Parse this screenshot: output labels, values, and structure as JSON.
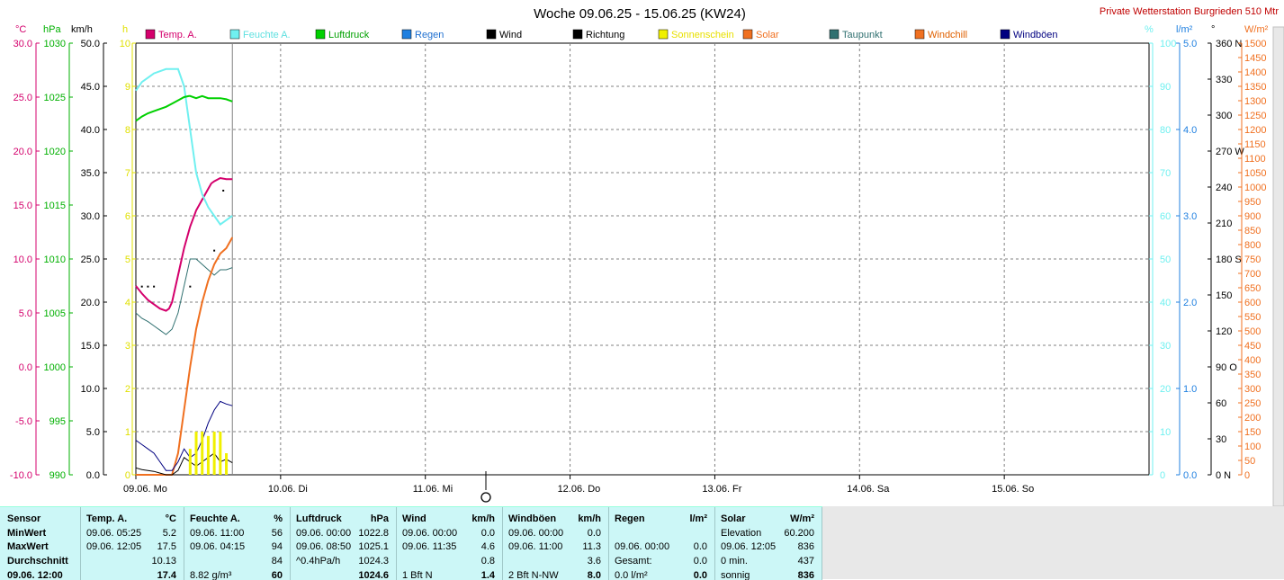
{
  "header": {
    "title": "Woche 09.06.25 - 15.06.25 (KW24)",
    "station": "Private Wetterstation Burgrieden 510 Mtr"
  },
  "axes": {
    "temp": {
      "unit": "°C",
      "ticks": [
        "30.0",
        "25.0",
        "20.0",
        "15.0",
        "10.0",
        "5.0",
        "0.0",
        "-5.0",
        "-10.0"
      ],
      "color": "#d4006c"
    },
    "pressure": {
      "unit": "hPa",
      "ticks": [
        "1030",
        "1025",
        "1020",
        "1015",
        "1010",
        "1005",
        "1000",
        "995",
        "990"
      ],
      "color": "#00b000"
    },
    "wind": {
      "unit": "km/h",
      "ticks": [
        "50.0",
        "45.0",
        "40.0",
        "35.0",
        "30.0",
        "25.0",
        "20.0",
        "15.0",
        "10.0",
        "5.0",
        "0.0"
      ],
      "color": "#000000"
    },
    "sunshine": {
      "unit": "h",
      "ticks": [
        "10",
        "9",
        "8",
        "7",
        "6",
        "5",
        "4",
        "3",
        "2",
        "1",
        "0"
      ],
      "color": "#e0e000"
    },
    "humidity": {
      "unit": "%",
      "ticks": [
        "100",
        "90",
        "80",
        "70",
        "60",
        "50",
        "40",
        "30",
        "20",
        "10",
        "0"
      ],
      "color": "#70f0f0"
    },
    "rain": {
      "unit": "l/m²",
      "ticks": [
        "5.0",
        "4.0",
        "3.0",
        "2.0",
        "1.0",
        "0.0"
      ],
      "color": "#2080e0"
    },
    "direction": {
      "unit": "°",
      "ticks": [
        "360 N",
        "330",
        "300",
        "270 W",
        "240",
        "210",
        "180 S",
        "150",
        "120",
        "90 O",
        "60",
        "30",
        "0 N"
      ],
      "color": "#000000"
    },
    "solar": {
      "unit": "W/m²",
      "ticks": [
        "1500",
        "1450",
        "1400",
        "1350",
        "1300",
        "1250",
        "1200",
        "1150",
        "1100",
        "1050",
        "1000",
        "950",
        "900",
        "850",
        "800",
        "750",
        "700",
        "650",
        "600",
        "550",
        "500",
        "450",
        "400",
        "350",
        "300",
        "250",
        "200",
        "150",
        "100",
        "50",
        "0"
      ],
      "color": "#f07020"
    }
  },
  "legend": [
    {
      "label": "Temp. A.",
      "color": "#d4006c"
    },
    {
      "label": "Feuchte A.",
      "color": "#70f0f0"
    },
    {
      "label": "Luftdruck",
      "color": "#00d000"
    },
    {
      "label": "Regen",
      "color": "#2080e0"
    },
    {
      "label": "Wind",
      "color": "#000000"
    },
    {
      "label": "Richtung",
      "color": "#000000"
    },
    {
      "label": "Sonnenschein",
      "color": "#f0f000"
    },
    {
      "label": "Solar",
      "color": "#f07020"
    },
    {
      "label": "Taupunkt",
      "color": "#307070"
    },
    {
      "label": "Windchill",
      "color": "#f07020"
    },
    {
      "label": "Windböen",
      "color": "#000080"
    }
  ],
  "days": [
    "09.06.  Mo",
    "10.06.  Di",
    "11.06.  Mi",
    "12.06.  Do",
    "13.06.  Fr",
    "14.06.  Sa",
    "15.06.  So"
  ],
  "chart_data": {
    "type": "line",
    "x_unit": "hours since 09.06. 00:00",
    "xlim": [
      0,
      168
    ],
    "series": [
      {
        "name": "Temp. A.",
        "unit": "°C",
        "color": "#d4006c",
        "x": [
          0,
          1,
          2,
          3,
          4,
          5,
          5.5,
          6,
          7,
          8,
          9,
          10,
          11,
          12,
          12.5,
          13,
          14,
          15,
          16
        ],
        "values": [
          7.5,
          6.8,
          6.2,
          5.8,
          5.4,
          5.2,
          5.4,
          6.0,
          8.5,
          11.0,
          13.0,
          14.5,
          15.5,
          16.5,
          17.0,
          17.2,
          17.5,
          17.4,
          17.4
        ]
      },
      {
        "name": "Feuchte A.",
        "unit": "%",
        "color": "#70f0f0",
        "x": [
          0,
          1,
          2,
          3,
          4,
          5,
          6,
          7,
          8,
          9,
          10,
          11,
          12,
          13,
          14,
          15,
          16
        ],
        "values": [
          89,
          91,
          92,
          93,
          93.5,
          94,
          94,
          94,
          90,
          80,
          70,
          65,
          62,
          60,
          58,
          59,
          60
        ]
      },
      {
        "name": "Luftdruck",
        "unit": "hPa",
        "color": "#00d000",
        "x": [
          0,
          1,
          2,
          3,
          4,
          5,
          6,
          7,
          8,
          8.8,
          9,
          10,
          11,
          12,
          13,
          14,
          15,
          16
        ],
        "values": [
          1022.8,
          1023.2,
          1023.5,
          1023.7,
          1023.9,
          1024.1,
          1024.4,
          1024.7,
          1025.0,
          1025.1,
          1025.1,
          1024.9,
          1025.1,
          1024.9,
          1024.9,
          1024.9,
          1024.8,
          1024.6
        ]
      },
      {
        "name": "Taupunkt",
        "unit": "°C",
        "color": "#307070",
        "x": [
          0,
          1,
          2,
          3,
          4,
          5,
          6,
          7,
          8,
          9,
          10,
          11,
          12,
          13,
          14,
          15,
          16
        ],
        "values": [
          5.0,
          4.5,
          4.2,
          3.8,
          3.4,
          3.0,
          3.5,
          5.0,
          7.5,
          10.0,
          10.0,
          9.5,
          9.0,
          8.5,
          9.0,
          9.0,
          9.2
        ]
      },
      {
        "name": "Windchill",
        "unit": "°C",
        "color": "#f07020",
        "x": [
          0,
          5,
          6,
          7,
          8,
          9,
          10,
          11,
          12,
          13,
          14,
          15,
          16
        ],
        "values": [
          -10,
          -10,
          -10,
          -8,
          -4,
          0,
          3.5,
          6.0,
          8.0,
          9.5,
          10.5,
          11.0,
          12.0
        ]
      },
      {
        "name": "Wind",
        "unit": "km/h",
        "color": "#000000",
        "x": [
          0,
          1,
          2,
          3,
          4,
          5,
          6,
          7,
          8,
          9,
          10,
          11,
          12,
          13,
          14,
          15,
          16
        ],
        "values": [
          0.8,
          0.6,
          0.5,
          0.4,
          0.2,
          0.0,
          0.0,
          0.5,
          2.0,
          1.5,
          1.0,
          1.5,
          2.0,
          2.5,
          1.5,
          1.8,
          1.4
        ]
      },
      {
        "name": "Windböen",
        "unit": "km/h",
        "color": "#000080",
        "x": [
          0,
          1,
          2,
          3,
          4,
          5,
          6,
          7,
          8,
          9,
          10,
          11,
          12,
          13,
          14,
          15,
          16
        ],
        "values": [
          4.0,
          3.5,
          3.0,
          2.5,
          1.5,
          0.5,
          0.5,
          1.5,
          3.0,
          2.0,
          2.5,
          4.0,
          6.0,
          7.5,
          8.5,
          8.2,
          8.0
        ]
      },
      {
        "name": "Richtung",
        "unit": "°",
        "color": "#000000",
        "type": "scatter",
        "x": [
          1,
          2,
          3,
          9,
          13,
          14.5
        ],
        "values": [
          157,
          157,
          157,
          157,
          187,
          237
        ]
      },
      {
        "name": "Sonnenschein",
        "unit": "h",
        "color": "#f0f000",
        "type": "bar",
        "x": [
          9,
          10,
          11,
          12,
          13,
          14,
          15
        ],
        "values": [
          0.6,
          1.0,
          1.0,
          0.9,
          1.0,
          1.0,
          0.5
        ]
      }
    ]
  },
  "stats": {
    "sensor": {
      "header": "Sensor",
      "rows": [
        "MinWert",
        "MaxWert",
        "Durchschnitt",
        "09.06. 12:00"
      ]
    },
    "temp": {
      "header": "Temp. A.",
      "unit": "°C",
      "rows": [
        [
          "09.06.  05:25",
          "5.2"
        ],
        [
          "09.06.  12:05",
          "17.5"
        ],
        [
          "",
          "10.13"
        ],
        [
          "",
          "17.4"
        ]
      ]
    },
    "hum": {
      "header": "Feuchte A.",
      "unit": "%",
      "rows": [
        [
          "09.06.  11:00",
          "56"
        ],
        [
          "09.06.  04:15",
          "94"
        ],
        [
          "",
          "84"
        ],
        [
          "8.82 g/m³",
          "60"
        ]
      ]
    },
    "press": {
      "header": "Luftdruck",
      "unit": "hPa",
      "rows": [
        [
          "09.06.  00:00",
          "1022.8"
        ],
        [
          "09.06.  08:50",
          "1025.1"
        ],
        [
          "^0.4hPa/h",
          "1024.3"
        ],
        [
          "",
          "1024.6"
        ]
      ]
    },
    "wind": {
      "header": "Wind",
      "unit": "km/h",
      "rows": [
        [
          "09.06.  00:00",
          "0.0"
        ],
        [
          "09.06.  11:35",
          "4.6"
        ],
        [
          "",
          "0.8"
        ],
        [
          "1 Bft N",
          "1.4"
        ]
      ]
    },
    "gust": {
      "header": "Windböen",
      "unit": "km/h",
      "rows": [
        [
          "09.06.  00:00",
          "0.0"
        ],
        [
          "09.06.  11:00",
          "11.3"
        ],
        [
          "",
          "3.6"
        ],
        [
          "2 Bft N-NW",
          "8.0"
        ]
      ]
    },
    "rain": {
      "header": "Regen",
      "unit": "l/m²",
      "rows": [
        [
          "",
          ""
        ],
        [
          "09.06.  00:00",
          "0.0"
        ],
        [
          "Gesamt:",
          "0.0"
        ],
        [
          "0.0 l/m²",
          "0.0"
        ]
      ]
    },
    "solar": {
      "header": "Solar",
      "unit": "W/m²",
      "rows": [
        [
          "Elevation",
          "60.200"
        ],
        [
          "09.06.  12:05",
          "836"
        ],
        [
          "0 min.",
          "437"
        ],
        [
          "sonnig",
          "836"
        ]
      ]
    }
  }
}
